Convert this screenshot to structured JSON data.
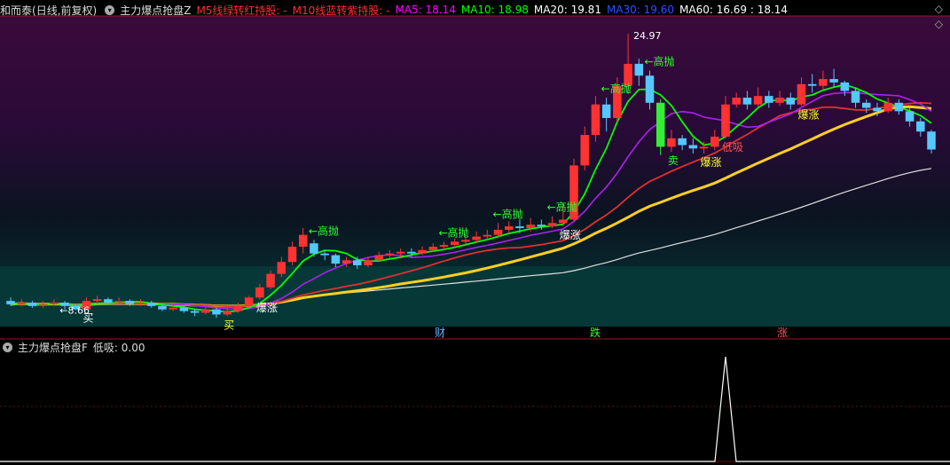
{
  "header": {
    "stock_label": "和而泰",
    "period_label": "(日线,前复权)",
    "indicator_name": "主力爆点抢盘Z",
    "signal_red": "M5线绿转红持股: -",
    "signal_red2": "M10线蓝转紫持股: -",
    "ma5": "MA5: 18.14",
    "ma10": "MA10: 18.98",
    "ma20": "MA20: 19.81",
    "ma30": "MA30: 19.60",
    "ma60": "MA60: 16.69 : 18.14"
  },
  "sub_header": {
    "indicator_name": "主力爆点抢盘F",
    "value_label": "低吸: 0.00"
  },
  "colors": {
    "up": "#ff3232",
    "down": "#54c8ff",
    "big_down": "#33ee33",
    "ma5": "#ff00ff",
    "ma10": "#00ff00",
    "ma20": "#0055ff",
    "ma30": "#4040ff",
    "ma60": "#cccccc",
    "ma_red": "#e03030",
    "ma_purple": "#aa22ee",
    "ma_yellow": "#ffd020",
    "ma_white": "#e0e0e0"
  },
  "chart_data": {
    "type": "candlestick",
    "price_labels": {
      "low": "8.66",
      "high": "24.97"
    },
    "bottom_markers": [
      {
        "text": "财",
        "color": "#5ab4ff"
      },
      {
        "text": "跌",
        "color": "#33ff33"
      },
      {
        "text": "涨",
        "color": "#ff5050"
      }
    ],
    "annotations": [
      {
        "text": "买",
        "color": "#ffffff",
        "x_index": 7
      },
      {
        "text": "买",
        "color": "#ffff33",
        "x_index": 20
      },
      {
        "text": "爆涨",
        "color": "#ffffff",
        "x_index": 23
      },
      {
        "text": "高抛",
        "color": "#33ff33",
        "x_index": 28
      },
      {
        "text": "高抛",
        "color": "#33ff33",
        "x_index": 40
      },
      {
        "text": "高抛",
        "color": "#33ff33",
        "x_index": 45
      },
      {
        "text": "高抛",
        "color": "#33ff33",
        "x_index": 50
      },
      {
        "text": "爆涨",
        "color": "#ffffff",
        "x_index": 51
      },
      {
        "text": "高抛",
        "color": "#33ff33",
        "x_index": 55
      },
      {
        "text": "高抛",
        "color": "#33ff33",
        "x_index": 59
      },
      {
        "text": "卖",
        "color": "#33ff33",
        "x_index": 61
      },
      {
        "text": "低吸",
        "color": "#ff5050",
        "x_index": 66
      },
      {
        "text": "爆涨",
        "color": "#ffff33",
        "x_index": 64
      },
      {
        "text": "爆涨",
        "color": "#ffff33",
        "x_index": 73
      }
    ],
    "candles": [
      [
        9.2,
        9.0,
        9.4,
        8.9
      ],
      [
        9.0,
        9.1,
        9.3,
        8.9
      ],
      [
        9.1,
        8.9,
        9.2,
        8.8
      ],
      [
        8.9,
        9.0,
        9.2,
        8.8
      ],
      [
        9.0,
        9.1,
        9.3,
        8.9
      ],
      [
        9.1,
        8.9,
        9.2,
        8.7
      ],
      [
        8.9,
        8.7,
        9.0,
        8.66
      ],
      [
        8.7,
        9.2,
        9.4,
        8.7
      ],
      [
        9.2,
        9.3,
        9.5,
        9.0
      ],
      [
        9.3,
        9.1,
        9.4,
        9.0
      ],
      [
        9.1,
        9.2,
        9.4,
        9.0
      ],
      [
        9.2,
        9.0,
        9.3,
        8.9
      ],
      [
        9.0,
        9.1,
        9.3,
        8.9
      ],
      [
        9.1,
        8.9,
        9.2,
        8.8
      ],
      [
        8.9,
        8.7,
        9.0,
        8.6
      ],
      [
        8.7,
        8.8,
        9.0,
        8.6
      ],
      [
        8.8,
        8.6,
        8.9,
        8.5
      ],
      [
        8.6,
        8.5,
        8.7,
        8.3
      ],
      [
        8.5,
        8.7,
        8.9,
        8.4
      ],
      [
        8.7,
        8.4,
        8.8,
        8.2
      ],
      [
        8.4,
        8.6,
        8.8,
        8.3
      ],
      [
        8.6,
        8.9,
        9.1,
        8.5
      ],
      [
        8.9,
        9.4,
        9.5,
        8.8
      ],
      [
        9.4,
        10.0,
        10.2,
        9.3
      ],
      [
        10.0,
        10.8,
        11.0,
        9.9
      ],
      [
        10.8,
        11.5,
        11.8,
        10.6
      ],
      [
        11.5,
        12.4,
        12.7,
        11.3
      ],
      [
        12.4,
        13.1,
        13.5,
        12.0
      ],
      [
        12.6,
        12.0,
        12.8,
        11.8
      ],
      [
        12.0,
        11.9,
        12.2,
        11.6
      ],
      [
        11.9,
        11.4,
        12.0,
        11.2
      ],
      [
        11.4,
        11.6,
        11.8,
        11.2
      ],
      [
        11.6,
        11.3,
        11.8,
        11.1
      ],
      [
        11.3,
        11.6,
        11.8,
        11.2
      ],
      [
        11.6,
        11.9,
        12.1,
        11.5
      ],
      [
        11.9,
        12.0,
        12.2,
        11.7
      ],
      [
        12.0,
        12.1,
        12.3,
        11.8
      ],
      [
        12.1,
        12.0,
        12.3,
        11.8
      ],
      [
        12.0,
        12.2,
        12.4,
        11.9
      ],
      [
        12.2,
        12.4,
        12.6,
        12.1
      ],
      [
        12.4,
        12.5,
        12.7,
        12.2
      ],
      [
        12.5,
        12.7,
        12.9,
        12.3
      ],
      [
        12.7,
        12.8,
        13.0,
        12.5
      ],
      [
        12.8,
        13.0,
        13.3,
        12.6
      ],
      [
        13.0,
        13.1,
        13.4,
        12.8
      ],
      [
        13.1,
        13.4,
        13.8,
        12.9
      ],
      [
        13.4,
        13.6,
        13.9,
        13.2
      ],
      [
        13.6,
        13.5,
        14.0,
        13.2
      ],
      [
        13.5,
        13.7,
        14.1,
        13.3
      ],
      [
        13.7,
        13.6,
        14.0,
        13.4
      ],
      [
        13.6,
        13.8,
        14.2,
        13.5
      ],
      [
        13.8,
        14.0,
        15.0,
        13.6
      ],
      [
        14.0,
        17.2,
        17.6,
        13.9
      ],
      [
        17.2,
        19.0,
        19.5,
        16.9
      ],
      [
        19.0,
        20.8,
        21.3,
        18.6
      ],
      [
        20.8,
        20.0,
        21.2,
        19.2
      ],
      [
        20.0,
        21.9,
        22.4,
        19.8
      ],
      [
        21.9,
        23.2,
        24.97,
        21.4
      ],
      [
        23.2,
        22.5,
        23.5,
        21.9
      ],
      [
        22.5,
        20.9,
        22.8,
        20.5
      ],
      [
        20.9,
        18.3,
        21.1,
        17.8
      ],
      [
        18.3,
        18.8,
        19.3,
        18.0
      ],
      [
        18.8,
        18.4,
        19.0,
        18.1
      ],
      [
        18.4,
        18.2,
        18.8,
        17.9
      ],
      [
        18.2,
        18.3,
        18.6,
        17.9
      ],
      [
        18.3,
        18.9,
        19.3,
        18.1
      ],
      [
        18.9,
        20.8,
        21.3,
        18.8
      ],
      [
        20.8,
        21.2,
        21.5,
        20.6
      ],
      [
        21.2,
        20.8,
        21.6,
        20.5
      ],
      [
        20.8,
        21.3,
        21.8,
        20.6
      ],
      [
        21.3,
        20.9,
        21.6,
        20.6
      ],
      [
        20.9,
        21.2,
        21.6,
        20.7
      ],
      [
        21.2,
        20.8,
        21.5,
        20.5
      ],
      [
        20.8,
        22.0,
        22.4,
        20.7
      ],
      [
        22.0,
        21.9,
        22.6,
        21.5
      ],
      [
        21.9,
        22.3,
        22.8,
        21.7
      ],
      [
        22.3,
        22.1,
        22.9,
        21.8
      ],
      [
        22.1,
        21.6,
        22.2,
        21.3
      ],
      [
        21.6,
        20.9,
        21.8,
        20.6
      ],
      [
        20.9,
        20.6,
        21.1,
        20.3
      ],
      [
        20.6,
        20.4,
        20.9,
        20.1
      ],
      [
        20.4,
        20.9,
        21.2,
        20.3
      ],
      [
        20.9,
        20.4,
        21.1,
        20.2
      ],
      [
        20.4,
        19.8,
        20.6,
        19.5
      ],
      [
        19.8,
        19.2,
        20.0,
        18.9
      ],
      [
        19.2,
        18.14,
        19.3,
        17.9
      ]
    ],
    "sub_series": {
      "name": "低吸",
      "values_nonzero_index": 66
    }
  }
}
